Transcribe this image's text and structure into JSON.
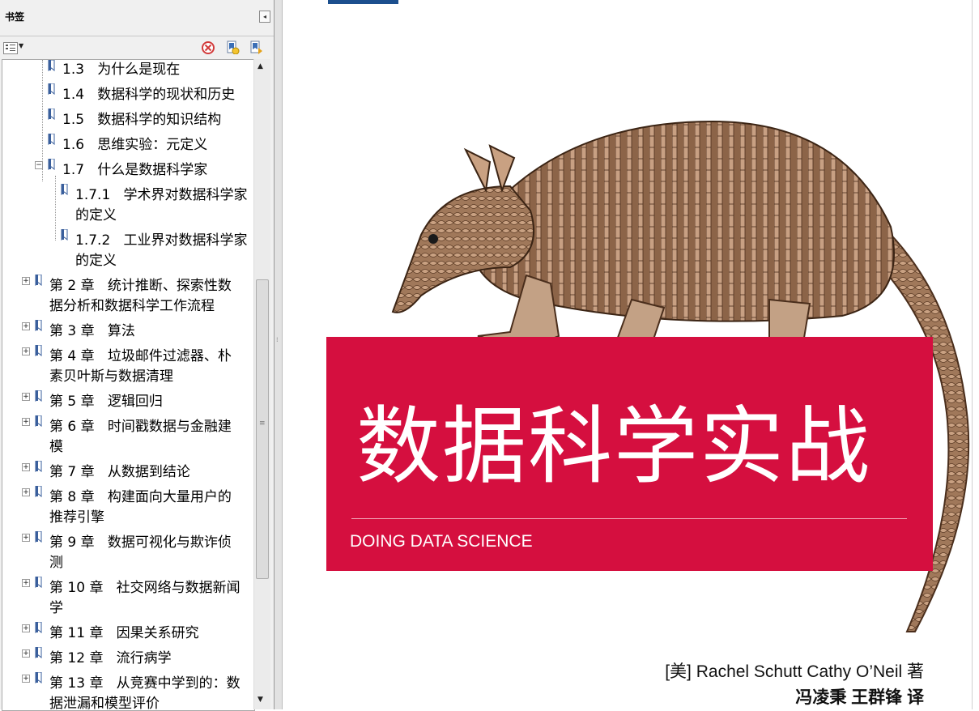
{
  "panel": {
    "title": "书签",
    "collapse_icon": "collapse-left-icon",
    "toolbar": {
      "options": "options-menu-icon",
      "delete": "delete-bookmark-icon",
      "new": "new-bookmark-icon",
      "expand": "expand-bookmark-icon"
    }
  },
  "bookmarks": [
    {
      "num": "1.3",
      "title": "为什么是现在"
    },
    {
      "num": "1.4",
      "title": "数据科学的现状和历史"
    },
    {
      "num": "1.5",
      "title": "数据科学的知识结构"
    },
    {
      "num": "1.6",
      "title": "思维实验：元定义"
    },
    {
      "num": "1.7",
      "title": "什么是数据科学家"
    },
    {
      "num": "1.7.1",
      "title": "学术界对数据科学家",
      "cont": "的定义"
    },
    {
      "num": "1.7.2",
      "title": "工业界对数据科学家",
      "cont": "的定义"
    },
    {
      "num": "第 2 章",
      "title": "统计推断、探索性数",
      "cont": "据分析和数据科学工作流程"
    },
    {
      "num": "第 3 章",
      "title": "算法"
    },
    {
      "num": "第 4 章",
      "title": "垃圾邮件过滤器、朴",
      "cont": "素贝叶斯与数据清理"
    },
    {
      "num": "第 5 章",
      "title": "逻辑回归"
    },
    {
      "num": "第 6 章",
      "title": "时间戳数据与金融建",
      "cont": "模"
    },
    {
      "num": "第 7 章",
      "title": "从数据到结论"
    },
    {
      "num": "第 8 章",
      "title": "构建面向大量用户的",
      "cont": "推荐引擎"
    },
    {
      "num": "第 9 章",
      "title": "数据可视化与欺诈侦",
      "cont": "测"
    },
    {
      "num": "第 10 章",
      "title": "社交网络与数据新闻",
      "cont": "学"
    },
    {
      "num": "第 11 章",
      "title": "因果关系研究"
    },
    {
      "num": "第 12 章",
      "title": "流行病学"
    },
    {
      "num": "第 13 章",
      "title": "从竞赛中学到的：数",
      "cont": "据泄漏和模型评价"
    }
  ],
  "cover": {
    "title": "数据科学实战",
    "subtitle": "DOING DATA SCIENCE",
    "authors": "[美] Rachel Schutt   Cathy O’Neil 著",
    "translators": "冯凌秉  王群锋 译",
    "accent_color": "#d50f3f",
    "illustration": "armadillo-illustration"
  }
}
